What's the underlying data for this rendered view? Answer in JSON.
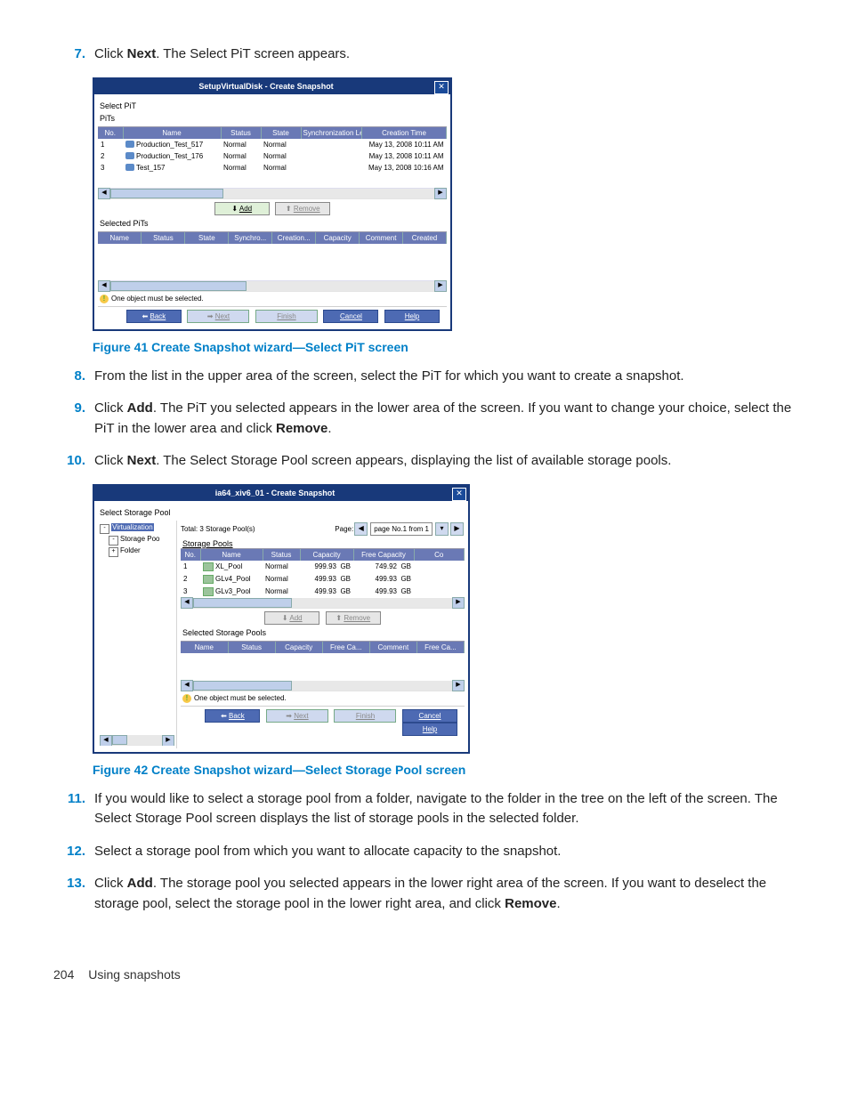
{
  "steps": {
    "s7_num": "7.",
    "s7_a": "Click ",
    "s7_b": "Next",
    "s7_c": ". The Select PiT screen appears.",
    "s8_num": "8.",
    "s8": "From the list in the upper area of the screen, select the PiT for which you want to create a snapshot.",
    "s9_num": "9.",
    "s9_a": "Click ",
    "s9_b": "Add",
    "s9_c": ". The PiT you selected appears in the lower area of the screen. If you want to change your choice, select the PiT in the lower area and click ",
    "s9_d": "Remove",
    "s9_e": ".",
    "s10_num": "10.",
    "s10_a": "Click ",
    "s10_b": "Next",
    "s10_c": ". The Select Storage Pool screen appears, displaying the list of available storage pools.",
    "s11_num": "11.",
    "s11": "If you would like to select a storage pool from a folder, navigate to the folder in the tree on the left of the screen. The Select Storage Pool screen displays the list of storage pools in the selected folder.",
    "s12_num": "12.",
    "s12": "Select a storage pool from which you want to allocate capacity to the snapshot.",
    "s13_num": "13.",
    "s13_a": "Click ",
    "s13_b": "Add",
    "s13_c": ". The storage pool you selected appears in the lower right area of the screen. If you want to deselect the storage pool, select the storage pool in the lower right area, and click ",
    "s13_d": "Remove",
    "s13_e": "."
  },
  "fig41": {
    "caption": "Figure 41 Create Snapshot wizard—Select PiT screen",
    "title": "SetupVirtualDisk - Create Snapshot",
    "select_pit": "Select PiT",
    "pits": "PiTs",
    "hdr": {
      "no": "No.",
      "name": "Name",
      "status": "Status",
      "state": "State",
      "sync": "Synchronization Level",
      "time": "Creation Time"
    },
    "rows": [
      {
        "no": "1",
        "name": "Production_Test_517",
        "status": "Normal",
        "state": "Normal",
        "time": "May 13, 2008 10:11 AM"
      },
      {
        "no": "2",
        "name": "Production_Test_176",
        "status": "Normal",
        "state": "Normal",
        "time": "May 13, 2008 10:11 AM"
      },
      {
        "no": "3",
        "name": "Test_157",
        "status": "Normal",
        "state": "Normal",
        "time": "May 13, 2008 10:16 AM"
      }
    ],
    "add": "Add",
    "remove": "Remove",
    "selected_pits": "Selected PiTs",
    "hdr2": {
      "name": "Name",
      "status": "Status",
      "state": "State",
      "sync": "Synchro...",
      "creation": "Creation...",
      "capacity": "Capacity",
      "comment": "Comment",
      "created": "Created"
    },
    "warn": "One object must be selected.",
    "back": "Back",
    "next": "Next",
    "finish": "Finish",
    "cancel": "Cancel",
    "help": "Help"
  },
  "fig42": {
    "caption": "Figure 42 Create Snapshot wizard—Select Storage Pool screen",
    "title": "ia64_xiv6_01 - Create Snapshot",
    "select_sp": "Select Storage Pool",
    "tree": {
      "virt": "Virtualization",
      "pool": "Storage Poo",
      "folder": "Folder"
    },
    "total": "Total: 3 Storage Pool(s)",
    "page_lbl": "Page:",
    "page_val": "page No.1 from 1",
    "sp_label": "Storage Pools",
    "hdr": {
      "no": "No.",
      "name": "Name",
      "status": "Status",
      "capacity": "Capacity",
      "free": "Free Capacity",
      "co": "Co"
    },
    "rows": [
      {
        "no": "1",
        "name": "XL_Pool",
        "status": "Normal",
        "cap": "999.93",
        "capu": "GB",
        "free": "749.92",
        "freeu": "GB"
      },
      {
        "no": "2",
        "name": "GLv4_Pool",
        "status": "Normal",
        "cap": "499.93",
        "capu": "GB",
        "free": "499.93",
        "freeu": "GB"
      },
      {
        "no": "3",
        "name": "GLv3_Pool",
        "status": "Normal",
        "cap": "499.93",
        "capu": "GB",
        "free": "499.93",
        "freeu": "GB"
      }
    ],
    "add": "Add",
    "remove": "Remove",
    "sel_sp": "Selected Storage Pools",
    "hdr2": {
      "name": "Name",
      "status": "Status",
      "capacity": "Capacity",
      "free": "Free Ca...",
      "comment": "Comment",
      "free2": "Free Ca..."
    },
    "warn": "One object must be selected.",
    "back": "Back",
    "next": "Next",
    "finish": "Finish",
    "cancel": "Cancel",
    "help": "Help"
  },
  "footer": {
    "page": "204",
    "section": "Using snapshots"
  }
}
